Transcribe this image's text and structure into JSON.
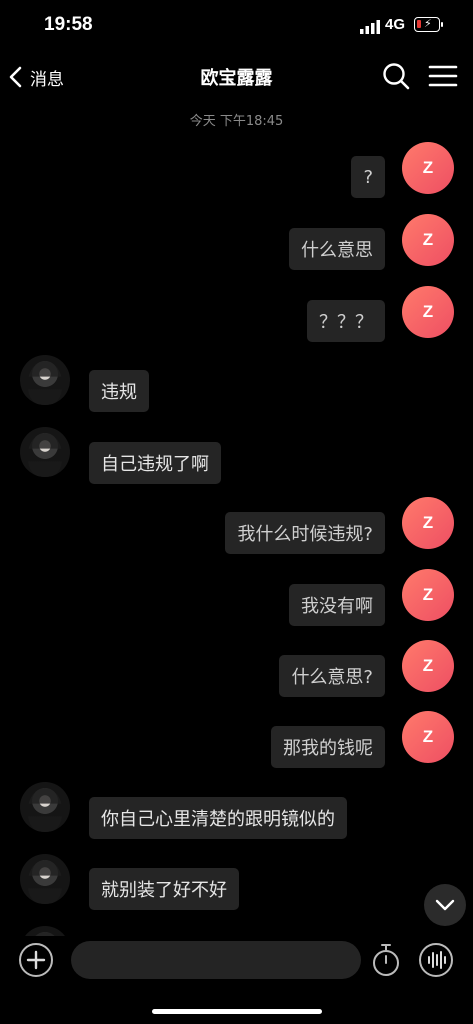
{
  "status_bar": {
    "time": "19:58",
    "network": "4G"
  },
  "nav": {
    "back_label": "消息",
    "title": "欧宝露露"
  },
  "timestamp": "今天 下午18:45",
  "me_avatar_letter": "Z",
  "messages": [
    {
      "from": "me",
      "text": "?"
    },
    {
      "from": "me",
      "text": "什么意思"
    },
    {
      "from": "me",
      "text": "？？？"
    },
    {
      "from": "other",
      "text": "违规"
    },
    {
      "from": "other",
      "text": "自己违规了啊"
    },
    {
      "from": "me",
      "text": "我什么时候违规?"
    },
    {
      "from": "me",
      "text": "我没有啊"
    },
    {
      "from": "me",
      "text": "什么意思?"
    },
    {
      "from": "me",
      "text": "那我的钱呢"
    },
    {
      "from": "other",
      "text": "你自己心里清楚的跟明镜似的"
    },
    {
      "from": "other",
      "text": "就别装了好不好"
    }
  ],
  "colors": {
    "me_avatar": "#ee4f63",
    "bubble": "#252525",
    "background": "#000000"
  }
}
